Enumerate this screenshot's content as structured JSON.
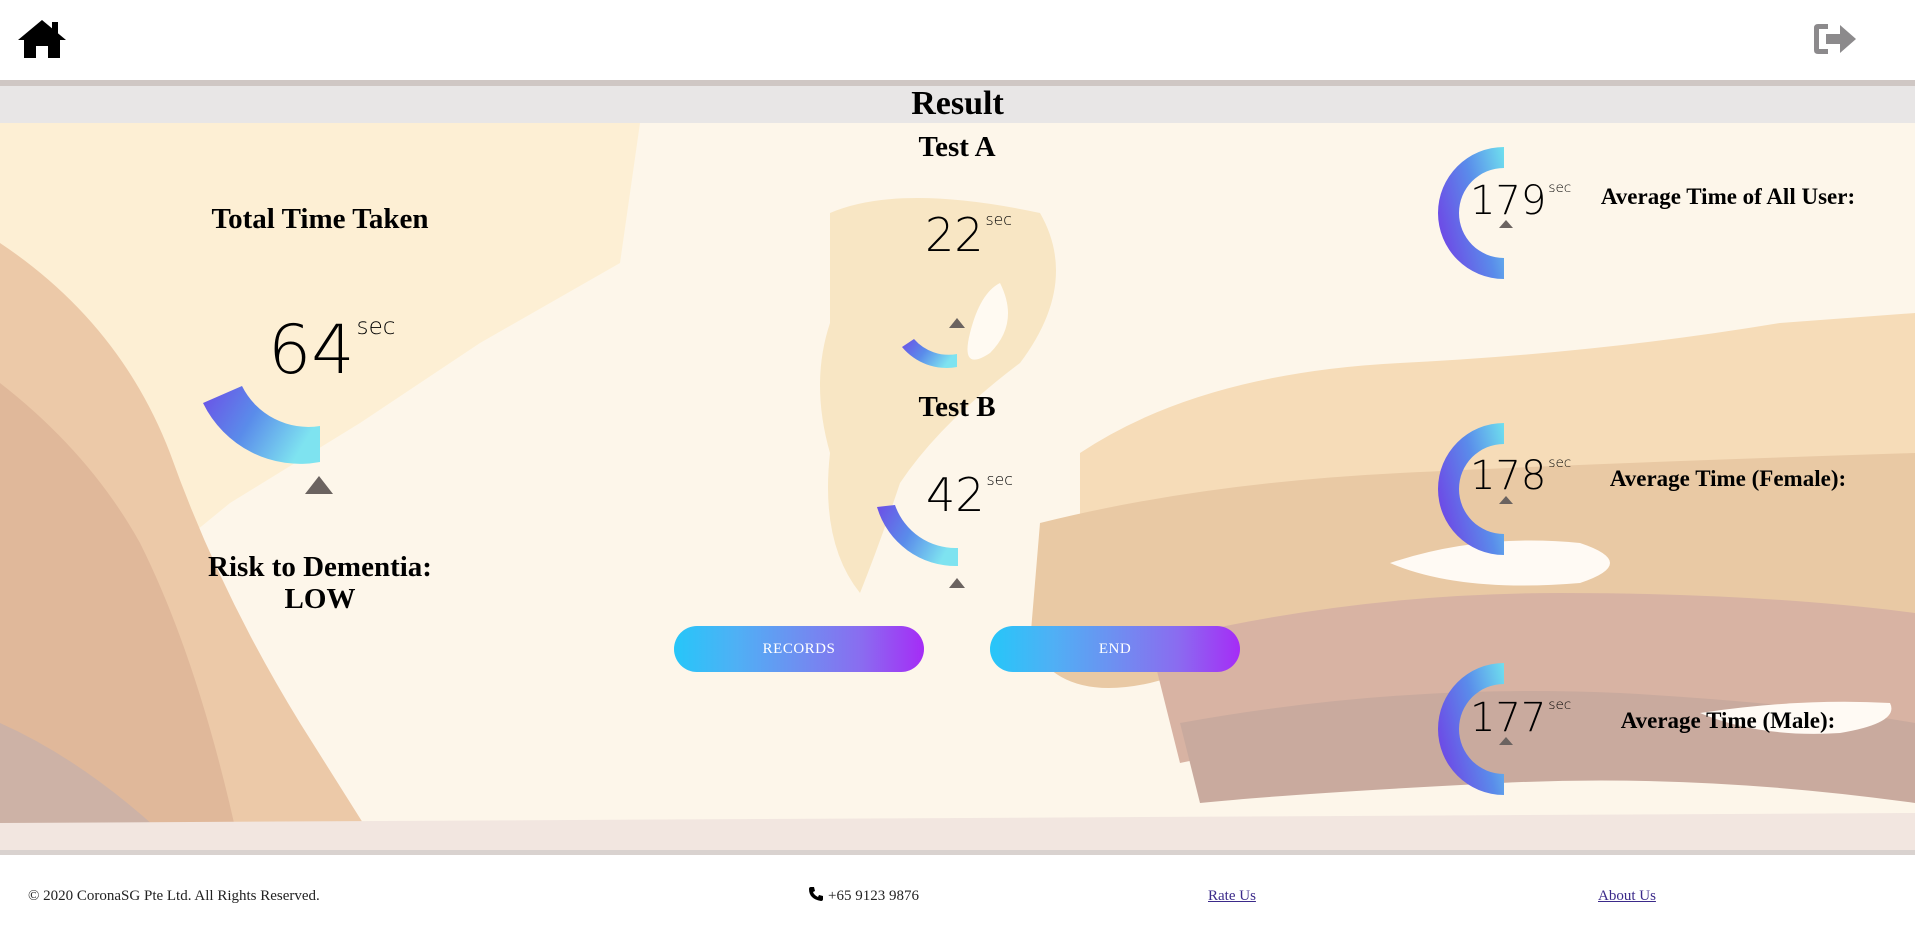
{
  "header": {
    "home_icon": "home-icon",
    "logout_icon": "logout-icon",
    "title": "Result"
  },
  "total": {
    "heading": "Total Time Taken",
    "value": "64",
    "unit": "sec",
    "risk_label": "Risk to Dementia:",
    "risk_value": "LOW"
  },
  "tests": [
    {
      "heading": "Test A",
      "value": "22",
      "unit": "sec"
    },
    {
      "heading": "Test B",
      "value": "42",
      "unit": "sec"
    }
  ],
  "averages": [
    {
      "label": "Average Time of All User:",
      "value": "179",
      "unit": "sec"
    },
    {
      "label": "Average Time (Female):",
      "value": "178",
      "unit": "sec"
    },
    {
      "label": "Average Time (Male):",
      "value": "177",
      "unit": "sec"
    }
  ],
  "buttons": {
    "records": "RECORDS",
    "end": "END"
  },
  "footer": {
    "copyright": "© 2020 CoronaSG Pte Ltd. All Rights Reserved.",
    "phone": "+65 9123 9876",
    "rate_us": "Rate Us",
    "about_us": "About Us"
  },
  "colors": {
    "gauge_start": "#6c4ee6",
    "gauge_end": "#7ee3f0",
    "button_start": "#26c6f9",
    "button_end": "#a52cf6"
  }
}
